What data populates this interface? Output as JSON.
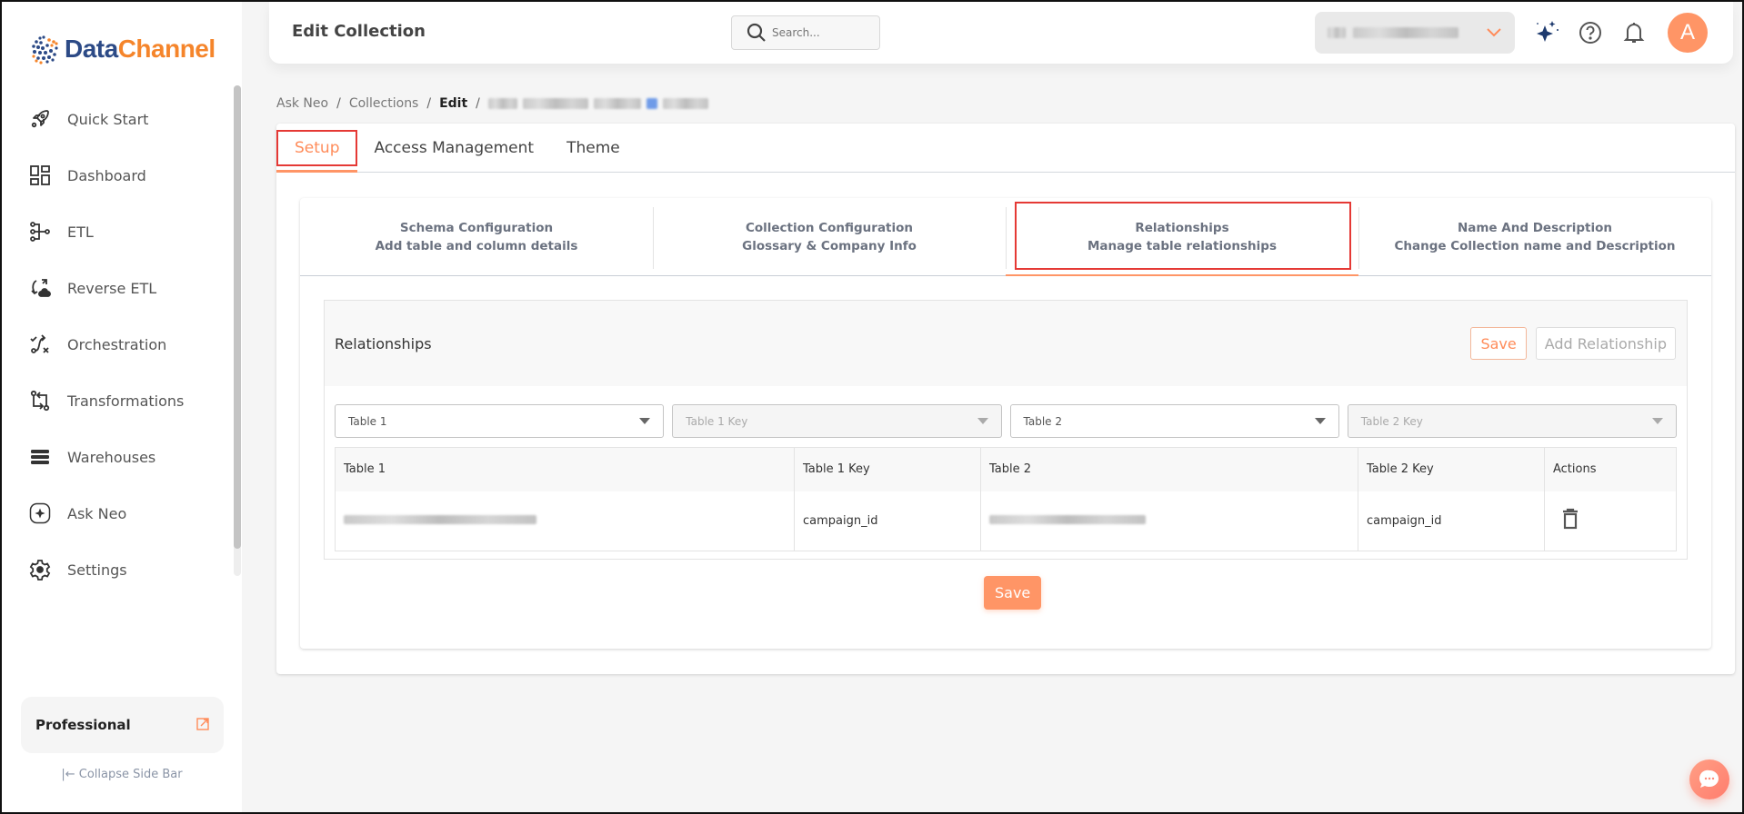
{
  "brand": {
    "name_part1": "Data",
    "name_part2": "Channel",
    "colors": {
      "blue": "#2c4a86",
      "orange": "#f5852b",
      "accent": "#ff9566",
      "highlight": "#e53935"
    }
  },
  "sidebar": {
    "items": [
      {
        "label": "Quick Start",
        "icon": "rocket-icon"
      },
      {
        "label": "Dashboard",
        "icon": "dashboard-icon"
      },
      {
        "label": "ETL",
        "icon": "etl-icon"
      },
      {
        "label": "Reverse ETL",
        "icon": "reverse-etl-icon"
      },
      {
        "label": "Orchestration",
        "icon": "orchestration-icon"
      },
      {
        "label": "Transformations",
        "icon": "transformations-icon"
      },
      {
        "label": "Warehouses",
        "icon": "warehouses-icon"
      },
      {
        "label": "Ask Neo",
        "icon": "ask-neo-icon"
      },
      {
        "label": "Settings",
        "icon": "gear-icon"
      }
    ],
    "plan": {
      "label": "Professional",
      "icon": "external-link-icon"
    },
    "collapse_label": "|← Collapse Side Bar"
  },
  "header": {
    "title": "Edit Collection",
    "search_placeholder": "Search...",
    "workspace_value": "[blurred workspace]",
    "avatar_initial": "A"
  },
  "breadcrumb": {
    "items": [
      "Ask Neo",
      "Collections",
      "Edit"
    ],
    "current_blurred": "[blurred collection name]"
  },
  "tabs": [
    {
      "label": "Setup",
      "active": true
    },
    {
      "label": "Access Management",
      "active": false
    },
    {
      "label": "Theme",
      "active": false
    }
  ],
  "steps": [
    {
      "title": "Schema Configuration",
      "subtitle": "Add table and column details",
      "active": false
    },
    {
      "title": "Collection Configuration",
      "subtitle": "Glossary & Company Info",
      "active": false
    },
    {
      "title": "Relationships",
      "subtitle": "Manage table relationships",
      "active": true
    },
    {
      "title": "Name And Description",
      "subtitle": "Change Collection name and Description",
      "active": false
    }
  ],
  "relationships": {
    "title": "Relationships",
    "save_label": "Save",
    "add_label": "Add Relationship",
    "selects": [
      {
        "placeholder": "Table 1",
        "disabled": false
      },
      {
        "placeholder": "Table 1 Key",
        "disabled": true
      },
      {
        "placeholder": "Table 2",
        "disabled": false
      },
      {
        "placeholder": "Table 2 Key",
        "disabled": true
      }
    ],
    "columns": [
      "Table 1",
      "Table 1 Key",
      "Table 2",
      "Table 2 Key",
      "Actions"
    ],
    "rows": [
      {
        "table1": "[blurred table name]",
        "table1_key": "campaign_id",
        "table2": "[blurred table name]",
        "table2_key": "campaign_id"
      }
    ]
  },
  "footer": {
    "save_label": "Save"
  }
}
